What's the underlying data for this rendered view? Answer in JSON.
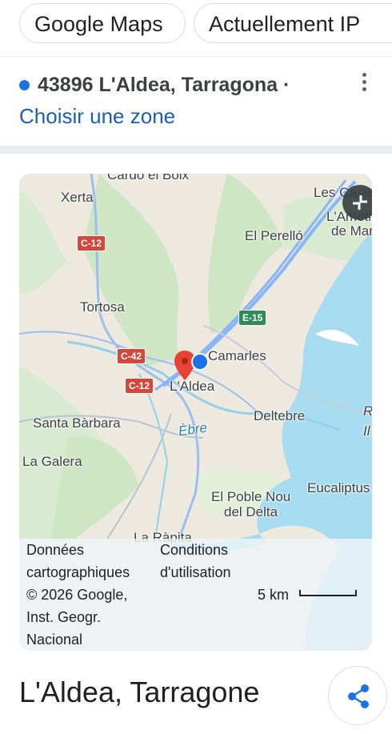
{
  "chips": [
    "Google Maps",
    "Actuellement IP"
  ],
  "location": {
    "text": "43896 L'Aldea, Tarragona ·",
    "link": "Choisir une zone"
  },
  "map": {
    "labels": {
      "cardo": "Cardó el Boix",
      "xerta": "Xerta",
      "lesCases": "Les Cases",
      "lAmetlla": "L'Ametlla",
      "deMar": "de Mar",
      "elPerello": "El Perelló",
      "tortosa": "Tortosa",
      "camarles": "Camarles",
      "laldea": "L'Aldea",
      "santaBarbara": "Santa Bàrbara",
      "deltebre": "Deltebre",
      "ebre": "Èbre",
      "rIl": "R\nIl",
      "laGalera": "La Galera",
      "pobleNou1": "El Poble Nou",
      "pobleNou2": "del Delta",
      "eucaliptus": "Eucaliptus",
      "laRapita": "La Ràpita"
    },
    "roads": {
      "c12a": "C-12",
      "c42": "C-42",
      "c12b": "C-12",
      "e15": "E-15"
    },
    "attribution": {
      "line1a": "Données",
      "line1b": "cartographiques",
      "line2": "© 2026 Google,",
      "line3": "Inst. Geogr.",
      "line4": "Nacional",
      "terms1": "Conditions",
      "terms2": "d'utilisation",
      "scale": "5 km"
    },
    "colors": {
      "water": "#a7dcf0",
      "land": "#eee9df",
      "green": "#cfe6c4",
      "road": "#8ab4f8",
      "pin": "#ea4335",
      "you": "#1a73e8"
    }
  },
  "title": "L'Aldea, Tarragone",
  "icons": {
    "more": "kebab-menu-icon",
    "exit": "exit-fullscreen-icon",
    "share": "share-icon",
    "pin": "map-pin-icon",
    "location": "current-location-icon"
  }
}
